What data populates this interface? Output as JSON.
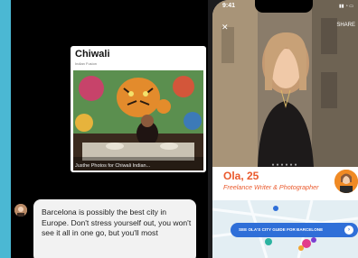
{
  "card": {
    "name": "Chiwali",
    "subtitle": "Indian Fusion",
    "caption": "Justhe Photos for Chiwali Indian..."
  },
  "chat": {
    "message": "Barcelona is possibly the best city in Europe. Don't stress yourself out, you won't see it all in one go, but you'll most"
  },
  "phone": {
    "time": "9:41",
    "share_label": "SHARE",
    "close_icon": "close-icon",
    "status_icons": "signal-wifi-battery",
    "profile_name": "Ola, 25",
    "profile_title": "Freelance Writer & Photographer",
    "guide_button": "SEE OLA'S CITY GUIDE FOR BARCELONE",
    "guide_arrow": "›"
  },
  "colors": {
    "background": "#4bb8d3",
    "accent_orange": "#ea5a2d",
    "button_blue": "#2f6fd8"
  }
}
